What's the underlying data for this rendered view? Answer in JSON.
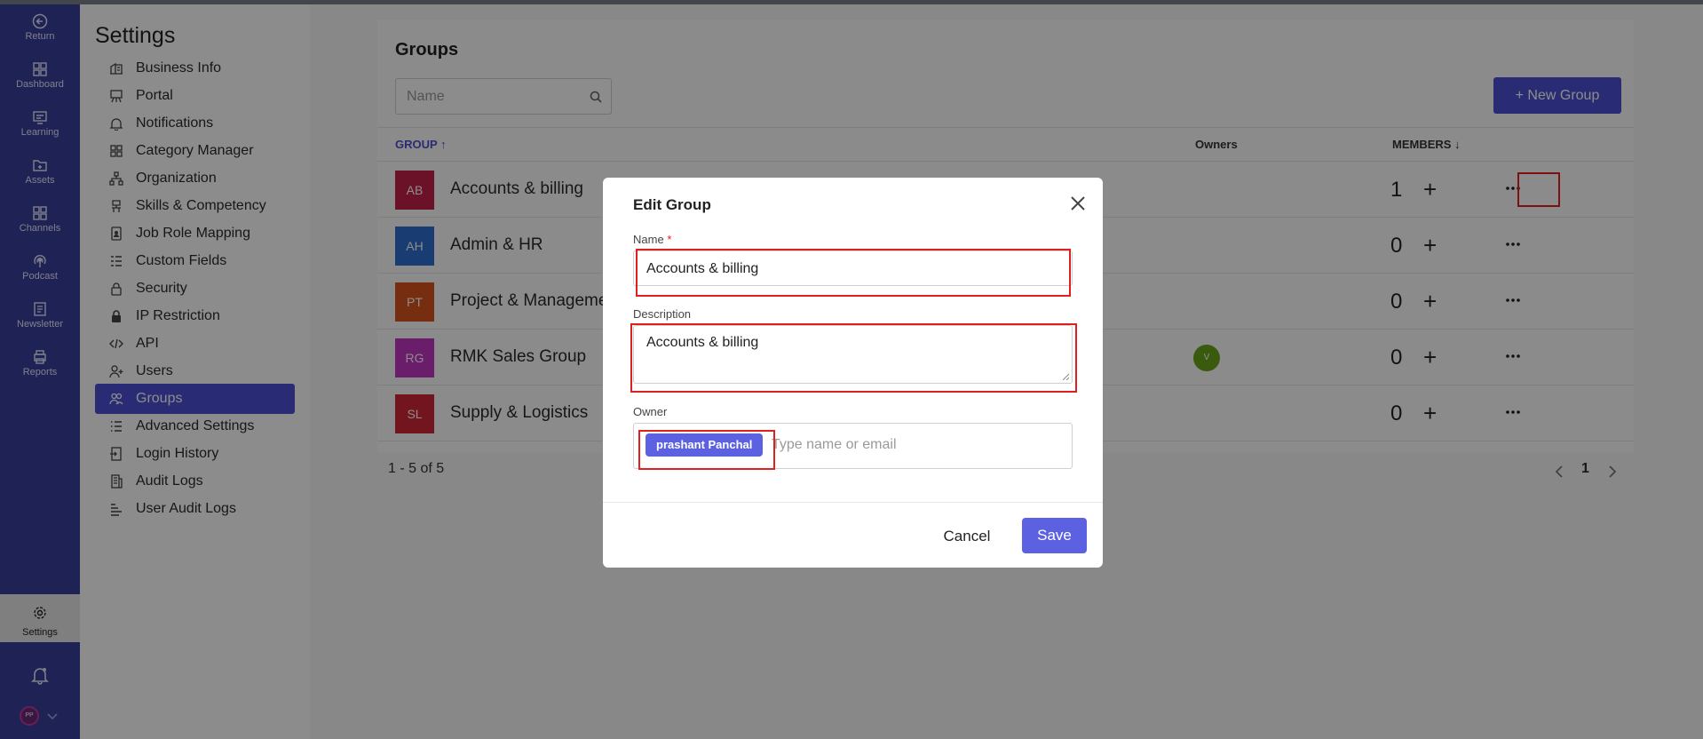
{
  "rail": {
    "items": [
      {
        "label": "Return",
        "icon": "return-icon"
      },
      {
        "label": "Dashboard",
        "icon": "dashboard-icon"
      },
      {
        "label": "Learning",
        "icon": "learning-icon"
      },
      {
        "label": "Assets",
        "icon": "assets-icon"
      },
      {
        "label": "Channels",
        "icon": "channels-icon"
      },
      {
        "label": "Podcast",
        "icon": "podcast-icon"
      },
      {
        "label": "Newsletter",
        "icon": "newsletter-icon"
      },
      {
        "label": "Reports",
        "icon": "reports-icon"
      }
    ],
    "settings_label": "Settings",
    "avatar_initials": "PP"
  },
  "sidebar": {
    "title": "Settings",
    "items": [
      {
        "label": "Business Info",
        "icon": "building-icon"
      },
      {
        "label": "Portal",
        "icon": "portal-icon"
      },
      {
        "label": "Notifications",
        "icon": "bell-icon"
      },
      {
        "label": "Category Manager",
        "icon": "grid-icon"
      },
      {
        "label": "Organization",
        "icon": "org-chart-icon"
      },
      {
        "label": "Skills & Competency",
        "icon": "skills-icon"
      },
      {
        "label": "Job Role Mapping",
        "icon": "id-badge-icon"
      },
      {
        "label": "Custom Fields",
        "icon": "fields-icon"
      },
      {
        "label": "Security",
        "icon": "lock-open-icon"
      },
      {
        "label": "IP Restriction",
        "icon": "lock-icon"
      },
      {
        "label": "API",
        "icon": "code-icon"
      },
      {
        "label": "Users",
        "icon": "user-plus-icon"
      },
      {
        "label": "Groups",
        "icon": "users-icon",
        "active": true
      },
      {
        "label": "Advanced Settings",
        "icon": "list-icon"
      },
      {
        "label": "Login History",
        "icon": "login-icon"
      },
      {
        "label": "Audit Logs",
        "icon": "audit-icon"
      },
      {
        "label": "User Audit Logs",
        "icon": "user-audit-icon"
      }
    ]
  },
  "groups_page": {
    "title": "Groups",
    "search_placeholder": "Name",
    "new_group_label": "+ New Group",
    "columns": {
      "group": "GROUP ↑",
      "owners": "Owners",
      "members": "MEMBERS ↓"
    },
    "rows": [
      {
        "initials": "AB",
        "name": "Accounts & billing",
        "members": "1",
        "color": "#c4214c"
      },
      {
        "initials": "AH",
        "name": "Admin & HR",
        "members": "0",
        "color": "#2f6fd1"
      },
      {
        "initials": "PT",
        "name": "Project & Manageme",
        "members": "0",
        "color": "#d9541e"
      },
      {
        "initials": "RG",
        "name": "RMK Sales Group",
        "members": "0",
        "color": "#c236c2",
        "owner_initial": "V"
      },
      {
        "initials": "SL",
        "name": "Supply & Logistics",
        "members": "0",
        "color": "#cf2738"
      }
    ],
    "pagination": {
      "summary": "1 - 5 of 5",
      "page": "1"
    }
  },
  "modal": {
    "title": "Edit Group",
    "name_label": "Name",
    "name_required": "*",
    "name_value": "Accounts & billing",
    "description_label": "Description",
    "description_value": "Accounts & billing",
    "owner_label": "Owner",
    "owner_chip": "prashant Panchal",
    "owner_placeholder": "Type name or email",
    "cancel_label": "Cancel",
    "save_label": "Save"
  },
  "colors": {
    "accent": "#4b50d3",
    "rail": "#3a3f9c",
    "highlight": "#e0201e"
  }
}
